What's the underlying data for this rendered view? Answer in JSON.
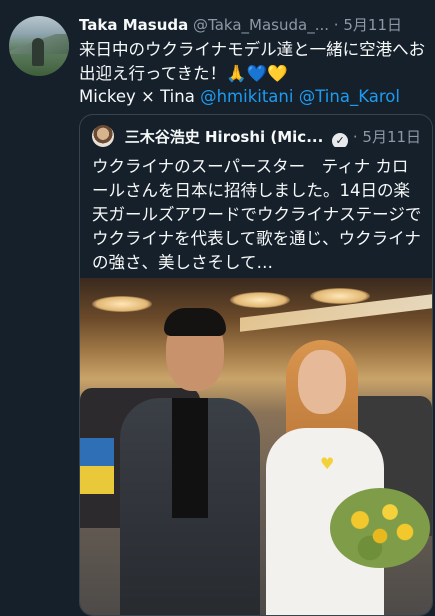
{
  "tweet": {
    "display_name": "Taka Masuda",
    "handle": "@Taka_Masuda_...",
    "separator": "·",
    "date": "5月11日",
    "text": "来日中のウクライナモデル達と一緒に空港へお出迎え行ってきた！🙏💙💛",
    "mentions_prefix": "Mickey × Tina",
    "mentions": [
      "@hmikitani",
      "@Tina_Karol"
    ]
  },
  "quoted_tweet": {
    "display_name": "三木谷浩史 Hiroshi (Mic...",
    "verified_icon": "verified-badge-icon",
    "separator": "·",
    "date": "5月11日",
    "text": "ウクライナのスーパースター　ティナ カロールさんを日本に招待しました。14日の楽天ガールズアワードでウクライナステージでウクライナを代表して歌を通じ、ウクライナの強さ、美しさそして…"
  },
  "colors": {
    "background": "#15202b",
    "text": "#f7f9f9",
    "secondary": "#8b98a5",
    "link": "#1d9bf0",
    "border": "#38444d"
  }
}
